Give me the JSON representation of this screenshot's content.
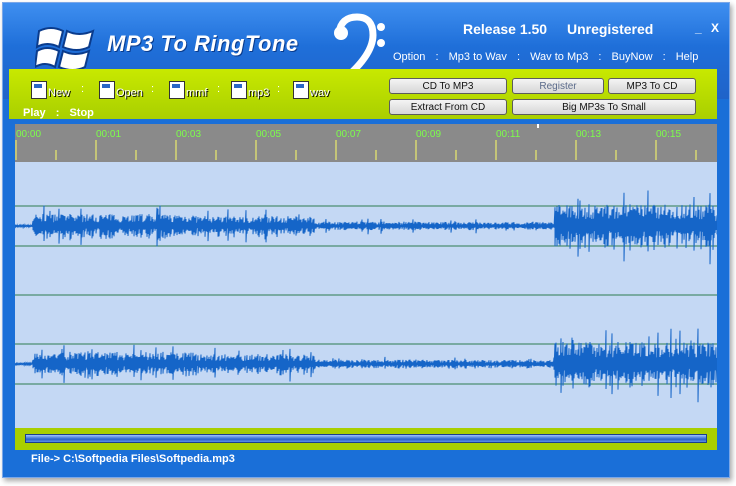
{
  "header": {
    "app_title": "MP3 To RingTone",
    "release": "Release 1.50",
    "status": "Unregistered",
    "minimize": "_",
    "close": "X"
  },
  "menu": {
    "items": [
      "Option",
      "Mp3 to Wav",
      "Wav to Mp3",
      "BuyNow",
      "Help"
    ],
    "separator": ":"
  },
  "toolbar": {
    "new": "New",
    "open": "Open",
    "mmf": "mmf",
    "mp3": "mp3",
    "wav": "wav",
    "separator": ":"
  },
  "playback": {
    "play": "Play",
    "stop": "Stop",
    "separator": ":"
  },
  "buttons": {
    "cd_to_mp3": "CD   To   MP3",
    "register": "Register",
    "mp3_to_cd": "MP3 To CD",
    "extract_from_cd": "Extract  From  CD",
    "big_mp3s_to_small": "Big  MP3s  To  Small"
  },
  "timeline": {
    "labels": [
      "00:00",
      "00:01",
      "00:03",
      "00:05",
      "00:07",
      "00:09",
      "00:11",
      "00:13",
      "00:15"
    ]
  },
  "status": {
    "file_path": "File-> C:\\Softpedia Files\\Softpedia.mp3"
  },
  "colors": {
    "header_blue": "#1f6fd9",
    "toolbar_green": "#b7dc00",
    "wave_background": "#c4d8f4",
    "waveform": "#1565c8",
    "timeline_label": "#7cff4a"
  },
  "icons": {
    "logo": "windows-flag-icon",
    "clef": "bass-clef-icon",
    "file": "floppy-disk-icon"
  }
}
